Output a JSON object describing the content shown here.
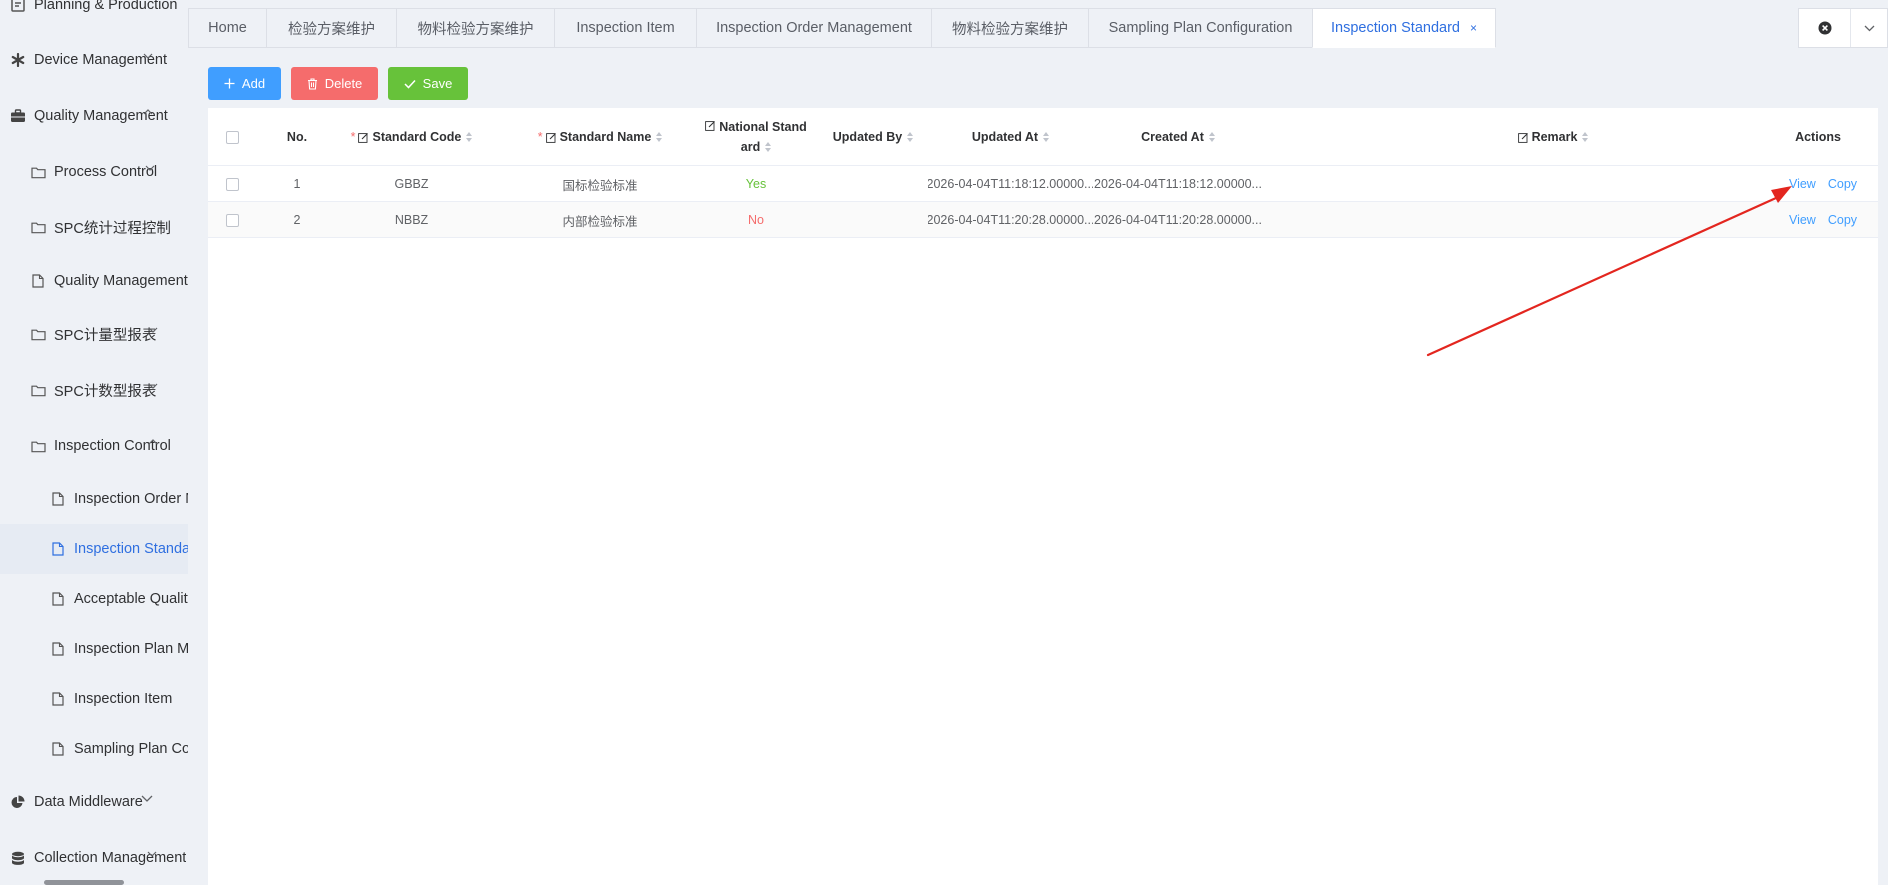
{
  "sidebar": {
    "items": [
      {
        "label": "Planning & Production",
        "icon": "planning-icon",
        "level": 1
      },
      {
        "label": "Device Management",
        "icon": "asterisk-icon",
        "level": 1
      },
      {
        "label": "Quality Management",
        "icon": "briefcase-icon",
        "level": 1
      },
      {
        "label": "Process Control",
        "icon": "folder-icon",
        "level": 2
      },
      {
        "label": "SPC统计过程控制",
        "icon": "folder-icon",
        "level": 2
      },
      {
        "label": "Quality Management I",
        "icon": "file-icon",
        "level": 2
      },
      {
        "label": "SPC计量型报表",
        "icon": "folder-icon",
        "level": 2
      },
      {
        "label": "SPC计数型报表",
        "icon": "folder-icon",
        "level": 2
      },
      {
        "label": "Inspection Control",
        "icon": "folder-icon",
        "level": 2
      },
      {
        "label": "Inspection Order M",
        "icon": "file-icon",
        "level": 3
      },
      {
        "label": "Inspection Standar",
        "icon": "file-icon",
        "level": 3
      },
      {
        "label": "Acceptable Quality",
        "icon": "file-icon",
        "level": 3
      },
      {
        "label": "Inspection Plan Ma",
        "icon": "file-icon",
        "level": 3
      },
      {
        "label": "Inspection Item",
        "icon": "file-icon",
        "level": 3
      },
      {
        "label": "Sampling Plan Cor",
        "icon": "file-icon",
        "level": 3
      },
      {
        "label": "Data Middleware",
        "icon": "pie-chart-icon",
        "level": 1
      },
      {
        "label": "Collection Management",
        "icon": "database-icon",
        "level": 1
      }
    ]
  },
  "tabs": [
    {
      "label": "Home"
    },
    {
      "label": "检验方案维护"
    },
    {
      "label": "物料检验方案维护"
    },
    {
      "label": "Inspection Item"
    },
    {
      "label": "Inspection Order Management"
    },
    {
      "label": "物料检验方案维护"
    },
    {
      "label": "Sampling Plan Configuration"
    },
    {
      "label": "Inspection Standard"
    }
  ],
  "tab_close": "×",
  "toolbar": {
    "add_label": "Add",
    "delete_label": "Delete",
    "save_label": "Save"
  },
  "table": {
    "columns": {
      "no": "No.",
      "code": "Standard Code",
      "name": "Standard Name",
      "national_1": "National Stand",
      "national_2": "ard",
      "updated_by": "Updated By",
      "updated_at": "Updated At",
      "created_at": "Created At",
      "remark": "Remark",
      "actions": "Actions"
    },
    "required_mark": "*",
    "rows": [
      {
        "no": "1",
        "code": "GBBZ",
        "name": "国标检验标准",
        "national": "Yes",
        "updated_by": "",
        "updated_at": "2026-04-04T11:18:12.00000...",
        "created_at": "2026-04-04T11:18:12.00000...",
        "remark": "",
        "view": "View",
        "copy": "Copy"
      },
      {
        "no": "2",
        "code": "NBBZ",
        "name": "内部检验标准",
        "national": "No",
        "updated_by": "",
        "updated_at": "2026-04-04T11:20:28.00000...",
        "created_at": "2026-04-04T11:20:28.00000...",
        "remark": "",
        "view": "View",
        "copy": "Copy"
      }
    ]
  },
  "colors": {
    "primary": "#409eff",
    "danger": "#f56c6c",
    "success": "#67c23a",
    "active_tab": "#2f6fe0",
    "annotation_arrow": "#e3261f"
  }
}
